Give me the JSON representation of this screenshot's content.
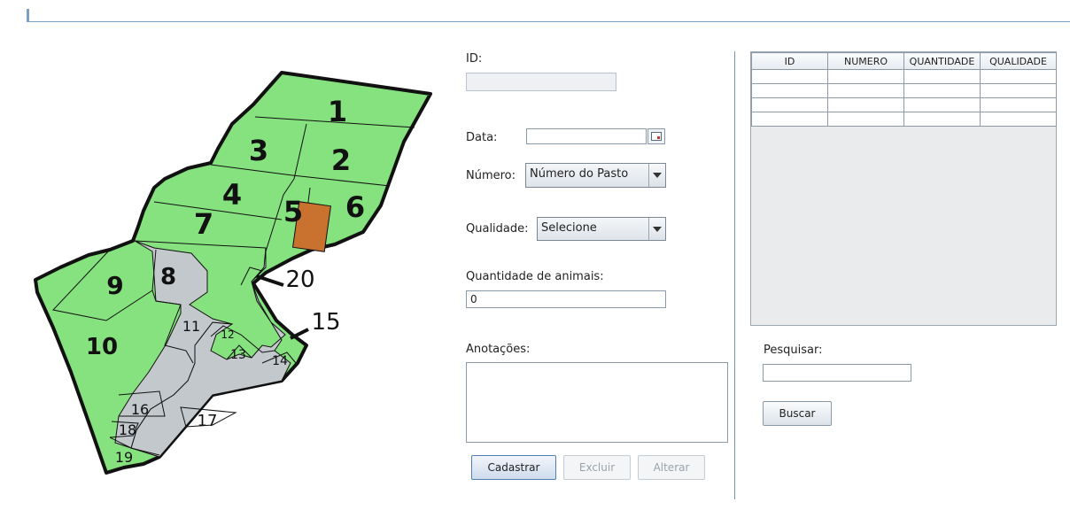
{
  "map": {
    "colors": {
      "pasture": "#86e17f",
      "road": "#c3c8cc",
      "highlight": "#c97230",
      "border": "#111111"
    },
    "labels": [
      "1",
      "2",
      "3",
      "4",
      "5",
      "6",
      "7",
      "8",
      "9",
      "10",
      "11",
      "12",
      "13",
      "14",
      "15",
      "16",
      "17",
      "18",
      "19",
      "20"
    ]
  },
  "form": {
    "id_label": "ID:",
    "id_value": "",
    "data_label": "Data:",
    "data_value": "",
    "calendar_icon": "calendar-icon",
    "numero_label": "Número:",
    "numero_selected": "Número do Pasto",
    "qualidade_label": "Qualidade:",
    "qualidade_selected": "Selecione",
    "quantidade_label": "Quantidade de animais:",
    "quantidade_value": "0",
    "anotacoes_label": "Anotações:",
    "anotacoes_value": "",
    "buttons": {
      "cadastrar": "Cadastrar",
      "excluir": "Excluir",
      "alterar": "Alterar"
    }
  },
  "table": {
    "columns": [
      "ID",
      "NUMERO",
      "QUANTIDADE",
      "QUALIDADE"
    ],
    "rows": [
      [
        "",
        "",
        "",
        ""
      ],
      [
        "",
        "",
        "",
        ""
      ],
      [
        "",
        "",
        "",
        ""
      ],
      [
        "",
        "",
        "",
        ""
      ]
    ]
  },
  "search": {
    "label": "Pesquisar:",
    "value": "",
    "button": "Buscar"
  }
}
